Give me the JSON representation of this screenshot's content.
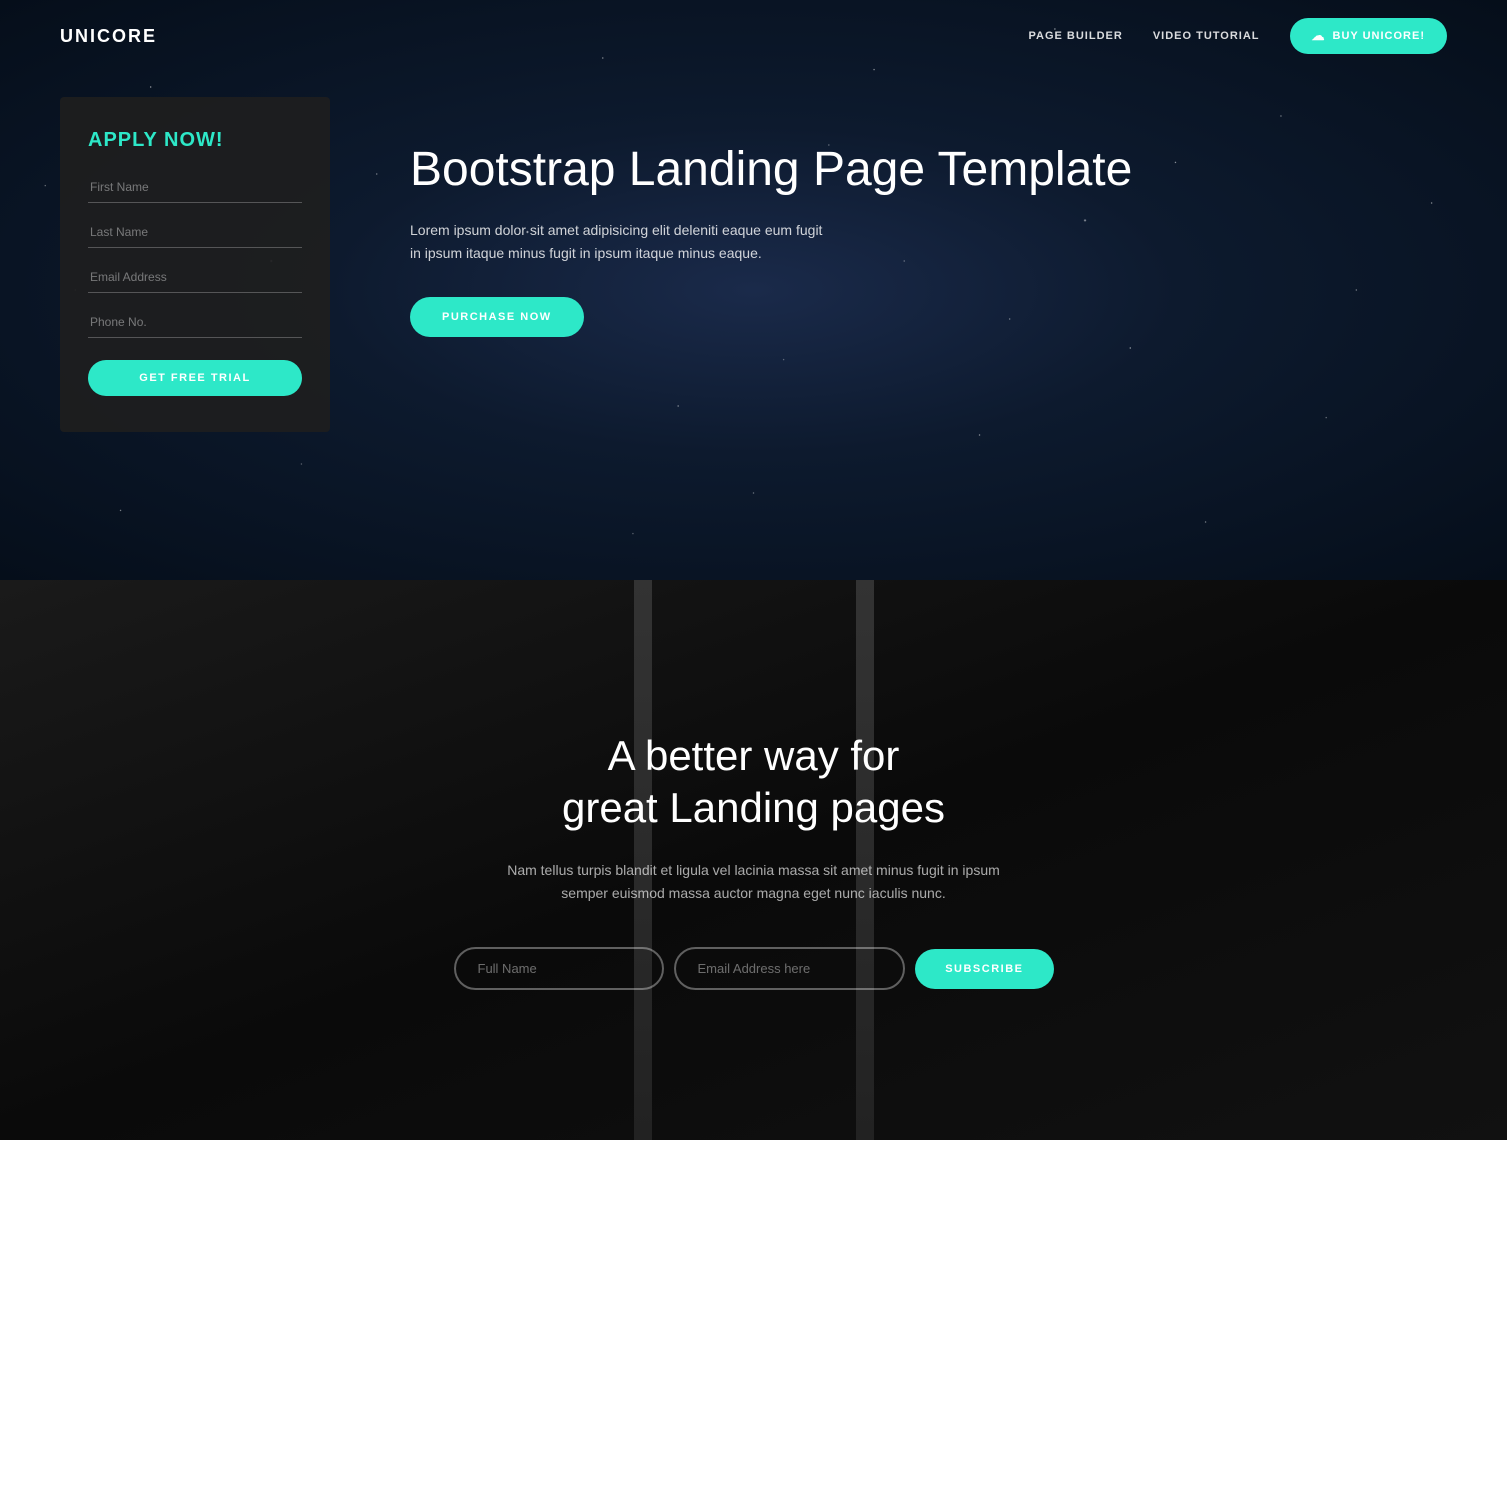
{
  "brand": "UNICORE",
  "navbar": {
    "links": [
      {
        "label": "PAGE BUILDER",
        "id": "page-builder"
      },
      {
        "label": "VIDEO TUTORIAL",
        "id": "video-tutorial"
      }
    ],
    "cta": {
      "label": "BUY UNICORE!",
      "icon": "☁"
    }
  },
  "hero": {
    "form": {
      "title": "APPLY NOW!",
      "fields": [
        {
          "id": "first-name",
          "placeholder": "First Name"
        },
        {
          "id": "last-name",
          "placeholder": "Last Name"
        },
        {
          "id": "email",
          "placeholder": "Email Address"
        },
        {
          "id": "phone",
          "placeholder": "Phone No."
        }
      ],
      "button": "GET FREE TRIAL"
    },
    "heading": "Bootstrap Landing Page Template",
    "description": "Lorem ipsum dolor sit amet adipisicing elit deleniti eaque eum fugit in ipsum itaque minus fugit in ipsum itaque minus eaque.",
    "cta": "PURCHASE NOW"
  },
  "escalator": {
    "heading_line1": "A better way for",
    "heading_line2": "great Landing pages",
    "description": "Nam tellus turpis blandit et ligula vel lacinia massa sit amet minus fugit in ipsum semper euismod massa auctor magna eget nunc iaculis nunc.",
    "subscribe": {
      "full_name_placeholder": "Full Name",
      "email_placeholder": "Email Address here",
      "button": "SUBSCRIBE"
    }
  },
  "colors": {
    "accent": "#2de8c8",
    "hero_bg_dark": "#0d1a2e",
    "card_bg": "rgba(30,30,30,0.92)"
  }
}
